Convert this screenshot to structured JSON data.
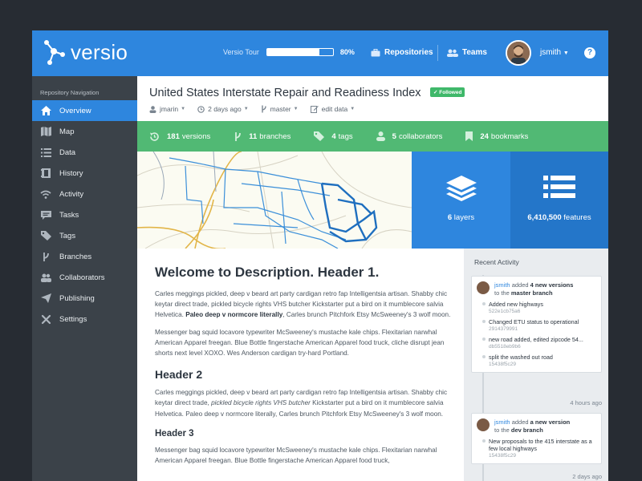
{
  "header": {
    "logo_text": "versio",
    "tour_label": "Versio Tour",
    "tour_progress": 0.8,
    "tour_percent": "80%",
    "nav_repositories": "Repositories",
    "nav_teams": "Teams",
    "username": "jsmith",
    "help": "?",
    "accent": "#2e86de"
  },
  "sidebar": {
    "title": "Repository Navigation",
    "items": [
      {
        "label": "Overview",
        "icon": "home-icon"
      },
      {
        "label": "Map",
        "icon": "map-icon"
      },
      {
        "label": "Data",
        "icon": "list-icon"
      },
      {
        "label": "History",
        "icon": "history-icon"
      },
      {
        "label": "Activity",
        "icon": "wifi-icon"
      },
      {
        "label": "Tasks",
        "icon": "tasks-icon"
      },
      {
        "label": "Tags",
        "icon": "tag-icon"
      },
      {
        "label": "Branches",
        "icon": "branch-icon"
      },
      {
        "label": "Collaborators",
        "icon": "users-icon"
      },
      {
        "label": "Publishing",
        "icon": "send-icon"
      },
      {
        "label": "Settings",
        "icon": "tools-icon"
      }
    ]
  },
  "repo": {
    "title": "United States Interstate Repair and Readiness Index",
    "followed": "Followed",
    "owner": "jmarin",
    "updated": "2 days ago",
    "branch": "master",
    "edit": "edit data"
  },
  "stats": {
    "versions": "181",
    "versions_label": "versions",
    "branches": "11",
    "branches_label": "branches",
    "tags": "4",
    "tags_label": "tags",
    "collaborators": "5",
    "collaborators_label": "collaborators",
    "bookmarks": "24",
    "bookmarks_label": "bookmarks"
  },
  "tiles": {
    "layers": "6",
    "layers_label": "layers",
    "features": "6,410,500",
    "features_label": "features"
  },
  "description": {
    "h1": "Welcome to Description. Header 1.",
    "p1a": "Carles meggings pickled, deep v beard art party cardigan retro fap Intelligentsia artisan. Shabby chic keytar direct trade, pickled bicycle rights VHS butcher Kickstarter put a bird on it mumblecore salvia Helvetica. ",
    "p1b": "Paleo deep v normcore literally",
    "p1c": ", Carles brunch Pitchfork Etsy McSweeney's 3 wolf moon.",
    "p2": "Messenger bag squid locavore typewriter McSweeney's mustache kale chips. Flexitarian narwhal American Apparel freegan. Blue Bottle fingerstache American Apparel food truck, cliche disrupt jean shorts next level XOXO. Wes Anderson cardigan try-hard Portland.",
    "h2": "Header 2",
    "p3a": "Carles meggings pickled, deep v beard art party cardigan retro fap Intelligentsia artisan. Shabby chic keytar direct trade, ",
    "p3b": "pickled bicycle rights VHS butcher",
    "p3c": " Kickstarter put a bird on it mumblecore salvia Helvetica. Paleo deep v normcore literally, Carles brunch Pitchfork Etsy McSweeney's 3 wolf moon.",
    "h3": "Header 3",
    "p4": "Messenger bag squid locavore typewriter McSweeney's mustache kale chips. Flexitarian narwhal American Apparel freegan. Blue Bottle fingerstache American Apparel food truck,"
  },
  "activity": {
    "title": "Recent Activity",
    "card1": {
      "user": "jsmith",
      "verb": "added",
      "what": "4 new versions",
      "to": "to the",
      "branch": "master branch",
      "commits": [
        {
          "msg": "Added new highways",
          "sha": "522e1cb75a6"
        },
        {
          "msg": "Changed ETU status to operational",
          "sha": "2914379991"
        },
        {
          "msg": "new road added, edited zipcode 54...",
          "sha": "db5518eb9b6"
        },
        {
          "msg": "split the washed out road",
          "sha": "15438f5c29"
        }
      ],
      "ago": "4 hours ago"
    },
    "card2": {
      "user": "jsmith",
      "verb": "added",
      "what": "a new version",
      "to": "to the",
      "branch": "dev branch",
      "commits": [
        {
          "msg": "New proposals to the 415 interstate as a few local highways",
          "sha": "15438f5c29"
        }
      ],
      "ago": "2 days ago"
    }
  }
}
